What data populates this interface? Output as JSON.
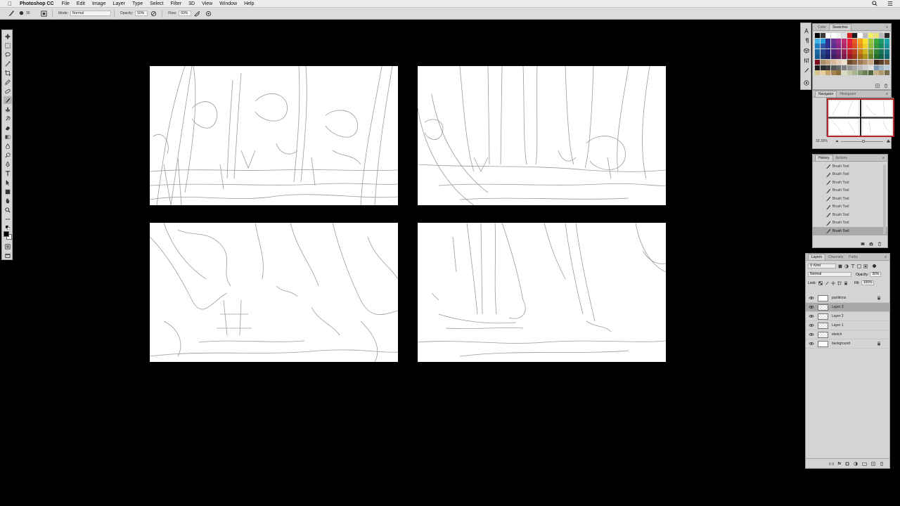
{
  "menubar": {
    "app_name": "Photoshop CC",
    "items": [
      "File",
      "Edit",
      "Image",
      "Layer",
      "Type",
      "Select",
      "Filter",
      "3D",
      "View",
      "Window",
      "Help"
    ]
  },
  "options": {
    "brush_size": "30",
    "mode_label": "Mode:",
    "mode_value": "Normal",
    "opacity_label": "Opacity:",
    "opacity_value": "50%",
    "flow_label": "Flow:",
    "flow_value": "60%"
  },
  "swatches_panel": {
    "tabs": [
      "Color",
      "Swatches"
    ],
    "active_tab": "Swatches",
    "colors": [
      "#000000",
      "#3a3a3a",
      "#ffffff",
      "#ffffff",
      "#f2f2f2",
      "#e1e1e1",
      "#d22020",
      "#1a1a1a",
      "#ffffff",
      "#bdbdbd",
      "#f4ef60",
      "#e8e176",
      "#b8b8b8",
      "#282828",
      "#3cb1e6",
      "#28a0dc",
      "#2e3190",
      "#6a3293",
      "#9b2f8e",
      "#c22b6e",
      "#e5223b",
      "#ea5b24",
      "#f8a21a",
      "#fbe22a",
      "#9bc83c",
      "#3aa83c",
      "#1c9a6c",
      "#1ba1a8",
      "#1f7dc3",
      "#2f57a4",
      "#2e3190",
      "#5c2d90",
      "#8c2a8b",
      "#b0276a",
      "#d7233a",
      "#dc4e24",
      "#e9921f",
      "#efd326",
      "#8fb93a",
      "#37993b",
      "#1b8c62",
      "#1a9099",
      "#1a6aa8",
      "#26488e",
      "#262a7d",
      "#4d267b",
      "#76247b",
      "#962259",
      "#b91e31",
      "#bd421f",
      "#c97c1b",
      "#cdb521",
      "#7a9e32",
      "#2f8332",
      "#167554",
      "#157984",
      "#1a5a8f",
      "#203d78",
      "#1f236a",
      "#402065",
      "#621d65",
      "#7d1c4a",
      "#9a1928",
      "#9d371a",
      "#a76817",
      "#ab961b",
      "#65842a",
      "#276d2a",
      "#136246",
      "#13656e",
      "#7b0c1b",
      "#a88e6b",
      "#c7a27a",
      "#d8b998",
      "#e6cfb4",
      "#f1e2cf",
      "#6b4a2e",
      "#8a6240",
      "#a07a52",
      "#b8936a",
      "#caa985",
      "#3b2a1a",
      "#5a3f26",
      "#7d5a38",
      "#1d1d1d",
      "#2c2c2c",
      "#3e3e3e",
      "#555555",
      "#6a6a6a",
      "#7f7f7f",
      "#959595",
      "#a8a8a8",
      "#bbbbbb",
      "#cecece",
      "#e0e0e0",
      "#7a98b0",
      "#9cb6c8",
      "#b9cbd8",
      "#d9c28e",
      "#e4cf9e",
      "#c9a76a",
      "#a4864f",
      "#8b6f3d",
      "#d9d9c5",
      "#c0c8a8",
      "#a8b48c",
      "#8a9a70",
      "#6f8058",
      "#55663f",
      "#c4b48e",
      "#ad9b6f",
      "#7b6b4a"
    ]
  },
  "navigator_panel": {
    "tabs": [
      "Navigator",
      "Histogram"
    ],
    "active_tab": "Navigator",
    "zoom": "33.33%"
  },
  "history_panel": {
    "tabs": [
      "History",
      "Actions"
    ],
    "active_tab": "History",
    "items": [
      "Brush Tool",
      "Brush Tool",
      "Brush Tool",
      "Brush Tool",
      "Brush Tool",
      "Brush Tool",
      "Brush Tool",
      "Brush Tool",
      "Brush Tool"
    ],
    "selected_index": 8
  },
  "layers_panel": {
    "tabs": [
      "Layers",
      "Channels",
      "Paths"
    ],
    "active_tab": "Layers",
    "filter_label": "Kind",
    "blend_mode": "Normal",
    "opacity_label": "Opacity:",
    "opacity_value": "30%",
    "lock_label": "Lock:",
    "fill_label": "Fill:",
    "fill_value": "100%",
    "layers": [
      {
        "name": "partitions",
        "locked": true,
        "selected": false
      },
      {
        "name": "Layer 3",
        "locked": false,
        "selected": true
      },
      {
        "name": "Layer 2",
        "locked": false,
        "selected": false
      },
      {
        "name": "Layer 1",
        "locked": false,
        "selected": false
      },
      {
        "name": "sketch",
        "locked": false,
        "selected": false
      },
      {
        "name": "background",
        "locked": true,
        "selected": false
      }
    ]
  },
  "colors": {
    "accent_red": "#b3262b",
    "selection_gray": "#a9a9a9",
    "sketch_stroke": "#8a8a8a"
  }
}
